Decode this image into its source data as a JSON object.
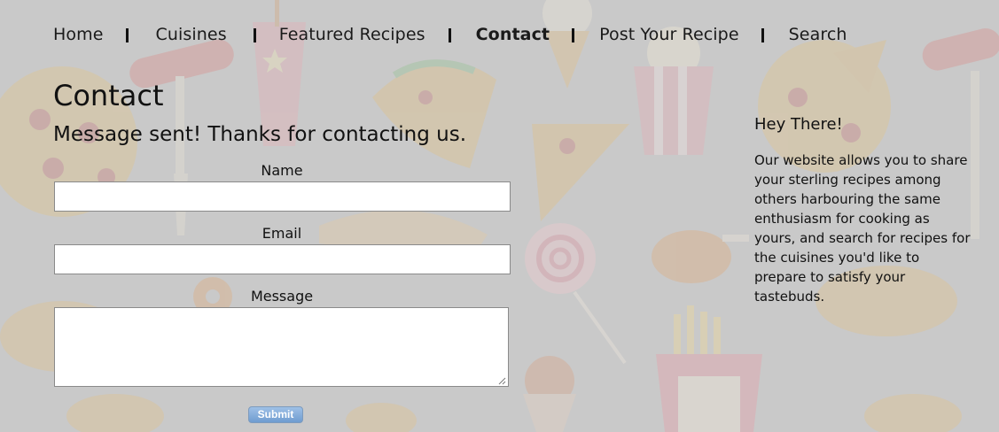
{
  "nav": {
    "items": [
      {
        "label": "Home"
      },
      {
        "label": "Cuisines"
      },
      {
        "label": "Featured Recipes"
      },
      {
        "label": "Contact",
        "active": true
      },
      {
        "label": "Post Your Recipe"
      },
      {
        "label": "Search"
      }
    ]
  },
  "main": {
    "title": "Contact",
    "status_message": "Message sent! Thanks for contacting us.",
    "form": {
      "name_label": "Name",
      "name_value": "",
      "email_label": "Email",
      "email_value": "",
      "message_label": "Message",
      "message_value": "",
      "submit_label": "Submit"
    }
  },
  "sidebar": {
    "heading": "Hey There!",
    "text": "Our website allows you to share your sterling recipes among others harbouring the same enthusiasm for cooking as yours, and search for recipes for the cuisines you'd like to prepare to satisfy your tastebuds."
  },
  "colors": {
    "background": "#c9c9c9",
    "submit_button": "#6f9cd0",
    "text": "#111111"
  }
}
